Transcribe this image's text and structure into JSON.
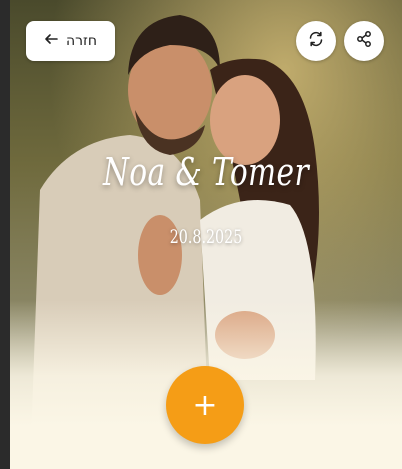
{
  "header": {
    "back_label": "חזרה"
  },
  "event": {
    "title": "Noa & Tomer",
    "date": "20.8.2025"
  },
  "icons": {
    "back": "arrow-left-icon",
    "refresh": "refresh-icon",
    "share": "share-icon",
    "add": "plus-icon"
  },
  "colors": {
    "accent": "#f59d16",
    "background": "#fbf6e6"
  },
  "fab": {
    "label": "+"
  }
}
